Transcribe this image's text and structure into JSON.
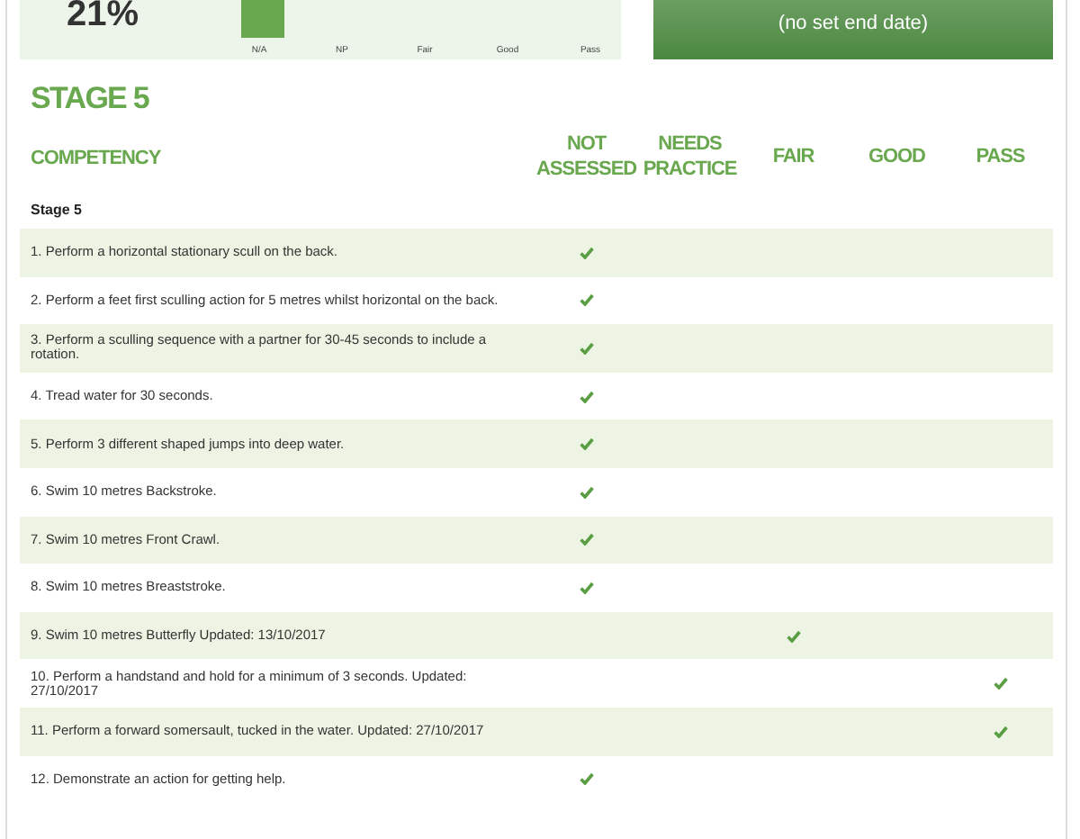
{
  "summary": {
    "percent": "21%",
    "bar_labels": [
      "N/A",
      "NP",
      "Fair",
      "Good",
      "Pass"
    ],
    "membership_note": "(no set end date)"
  },
  "stage": {
    "title": "STAGE 5",
    "group_label": "Stage 5"
  },
  "columns": [
    "COMPETENCY",
    "NOT ASSESSED",
    "NEEDS PRACTICE",
    "FAIR",
    "GOOD",
    "PASS"
  ],
  "rows": [
    {
      "text": "1. Perform a horizontal stationary scull on the back.",
      "marks": [
        true,
        false,
        false,
        false,
        false
      ]
    },
    {
      "text": "2. Perform a feet first sculling action for 5 metres whilst horizontal on the back.",
      "marks": [
        true,
        false,
        false,
        false,
        false
      ]
    },
    {
      "text": "3. Perform a sculling sequence with a partner for 30-45 seconds to include a rotation.",
      "marks": [
        true,
        false,
        false,
        false,
        false
      ]
    },
    {
      "text": "4. Tread water for 30 seconds.",
      "marks": [
        true,
        false,
        false,
        false,
        false
      ]
    },
    {
      "text": "5. Perform 3 different shaped jumps into deep water.",
      "marks": [
        true,
        false,
        false,
        false,
        false
      ]
    },
    {
      "text": "6. Swim 10 metres Backstroke.",
      "marks": [
        true,
        false,
        false,
        false,
        false
      ]
    },
    {
      "text": "7. Swim 10 metres Front Crawl.",
      "marks": [
        true,
        false,
        false,
        false,
        false
      ]
    },
    {
      "text": "8. Swim 10 metres Breaststroke.",
      "marks": [
        true,
        false,
        false,
        false,
        false
      ]
    },
    {
      "text": "9. Swim 10 metres Butterfly Updated: 13/10/2017",
      "marks": [
        false,
        false,
        true,
        false,
        false
      ]
    },
    {
      "text": "10. Perform a handstand and hold for a minimum of 3 seconds. Updated: 27/10/2017",
      "marks": [
        false,
        false,
        false,
        false,
        true
      ]
    },
    {
      "text": "11. Perform a forward somersault, tucked in the water. Updated: 27/10/2017",
      "marks": [
        false,
        false,
        false,
        false,
        true
      ]
    },
    {
      "text": "12. Demonstrate an action for getting help.",
      "marks": [
        true,
        false,
        false,
        false,
        false
      ]
    }
  ]
}
